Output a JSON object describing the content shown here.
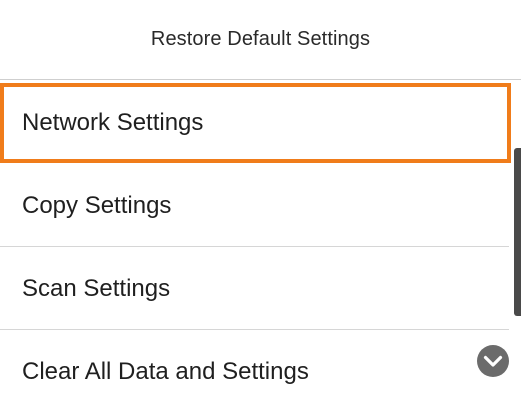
{
  "header": {
    "title": "Restore Default Settings"
  },
  "menu": {
    "items": [
      {
        "label": "Network Settings",
        "selected": true
      },
      {
        "label": "Copy Settings",
        "selected": false
      },
      {
        "label": "Scan Settings",
        "selected": false
      },
      {
        "label": "Clear All Data and Settings",
        "selected": false
      }
    ]
  },
  "icons": {
    "scroll_down": "chevron-down-circle-icon"
  },
  "colors": {
    "selection_border": "#f07c1a",
    "scroll_icon": "#6b6b6b"
  }
}
